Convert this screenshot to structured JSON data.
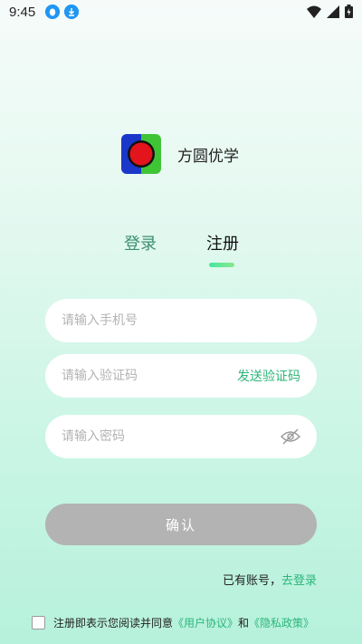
{
  "status_bar": {
    "time": "9:45"
  },
  "app": {
    "name": "方圆优学"
  },
  "tabs": {
    "login": "登录",
    "register": "注册"
  },
  "form": {
    "phone_placeholder": "请输入手机号",
    "code_placeholder": "请输入验证码",
    "send_code": "发送验证码",
    "password_placeholder": "请输入密码"
  },
  "confirm_label": "确认",
  "account": {
    "prefix": "已有账号，",
    "go_login": "去登录"
  },
  "agreement": {
    "text": "注册即表示您阅读并同意",
    "user_agreement": "《用户协议》",
    "and": "和",
    "privacy_policy": "《隐私政策》"
  },
  "colors": {
    "accent": "#2db67a",
    "button_disabled": "#b3b3b3"
  }
}
